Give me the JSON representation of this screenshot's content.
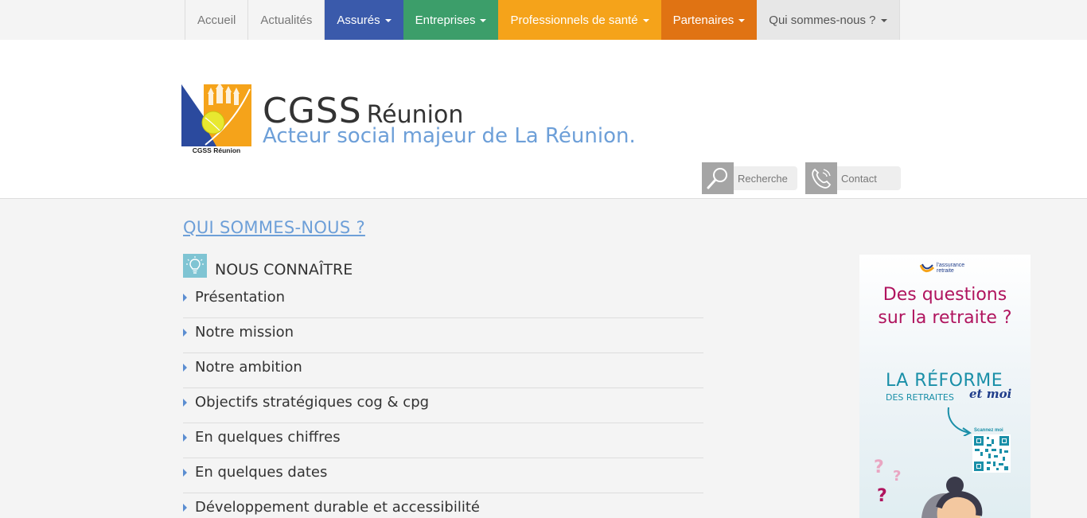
{
  "nav": {
    "items": [
      {
        "label": "Accueil",
        "dropdown": false
      },
      {
        "label": "Actualités",
        "dropdown": false
      },
      {
        "label": "Assurés",
        "dropdown": true
      },
      {
        "label": "Entreprises",
        "dropdown": true
      },
      {
        "label": "Professionnels de santé",
        "dropdown": true
      },
      {
        "label": "Partenaires",
        "dropdown": true
      },
      {
        "label": "Qui sommes-nous ?",
        "dropdown": true,
        "active": true
      }
    ],
    "colors": {
      "assures": "#3a5aab",
      "entreprises": "#3c9e6a",
      "professionnels": "#f5a31a",
      "partenaires": "#e07313"
    }
  },
  "header": {
    "logo_caption": "CGSS Réunion",
    "brand_main": "CGSS",
    "brand_sub": "Réunion",
    "tagline": "Acteur social majeur de La Réunion.",
    "search_label": "Recherche",
    "contact_label": "Contact",
    "search_icon": "magnifier-icon",
    "contact_icon": "phone-icon"
  },
  "main": {
    "page_title": "QUI SOMMES-NOUS ?",
    "section_title": "NOUS CONNAÎTRE",
    "section_icon": "lightbulb-icon",
    "links": [
      "Présentation",
      "Notre mission",
      "Notre ambition",
      "Objectifs stratégiques cog & cpg",
      "En quelques chiffres",
      "En quelques dates",
      "Développement durable et accessibilité"
    ]
  },
  "banner": {
    "logo_text_1": "l'assurance",
    "logo_text_2": "retraite",
    "question_line1": "Des questions",
    "question_line2": "sur la retraite ?",
    "reform_title": "LA RÉFORME",
    "reform_sub": "DES RETRAITES",
    "reform_moi": "et moi",
    "scan_label": "Scannez moi"
  },
  "colors": {
    "accent_blue": "#6d9fd8",
    "banner_magenta": "#b0145e",
    "banner_teal": "#1a8fa8"
  }
}
